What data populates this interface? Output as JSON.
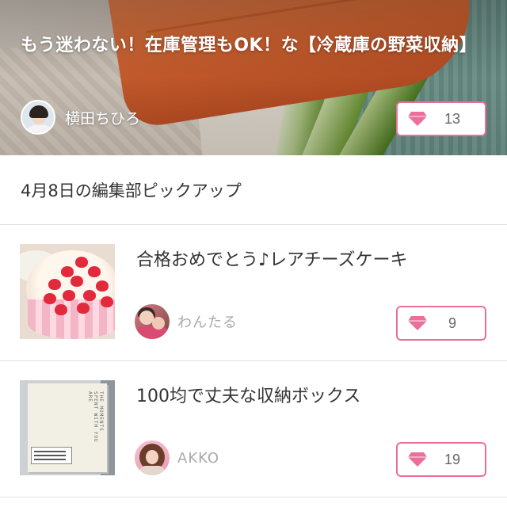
{
  "hero": {
    "title": "もう迷わない！在庫管理もOK！な【冷蔵庫の野菜収納】",
    "author": "横田ちひろ",
    "likes": "13"
  },
  "section": {
    "heading": "4月8日の編集部ピックアップ"
  },
  "articles": [
    {
      "title": "合格おめでとう♪レアチーズケーキ",
      "author": "わんたる",
      "likes": "9"
    },
    {
      "title": "100均で丈夫な収納ボックス",
      "author": "AKKO",
      "likes": "19"
    }
  ],
  "thumb_text": {
    "box_print": "THE MOMENTS SPENT WITH YOU ARE"
  },
  "colors": {
    "accent": "#ec6f9b",
    "divider": "#e2e2e2"
  },
  "icons": {
    "like": "diamond-icon"
  }
}
